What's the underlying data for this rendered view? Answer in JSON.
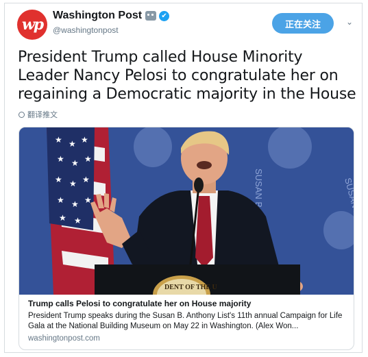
{
  "author": {
    "display_name": "Washington Post",
    "handle": "@washingtonpost",
    "avatar_text": "wp",
    "verified_icon": "✔"
  },
  "header": {
    "follow_label": "正在关注",
    "menu_icon": "⌄"
  },
  "tweet": {
    "text": "President Trump called House Minority Leader Nancy Pelosi to congratulate her on regaining a Democratic majority in the House",
    "translate_label": "翻译推文"
  },
  "card": {
    "title": "Trump calls Pelosi to congratulate her on House majority",
    "description": "President Trump speaks during the Susan B. Anthony List's 11th annual Campaign for Life Gala at the National Building Museum on May 22 in Washington. (Alex Won...",
    "domain": "washingtonpost.com",
    "image_backdrop_text_1": "SUSAN B. A",
    "image_backdrop_text_2": "SUSAN B. A",
    "podium_seal_text": "DENT OF THE U"
  },
  "colors": {
    "brand_blue": "#4ba3e6",
    "verified": "#1da1f2",
    "avatar": "#e0312e",
    "muted": "#657786"
  }
}
